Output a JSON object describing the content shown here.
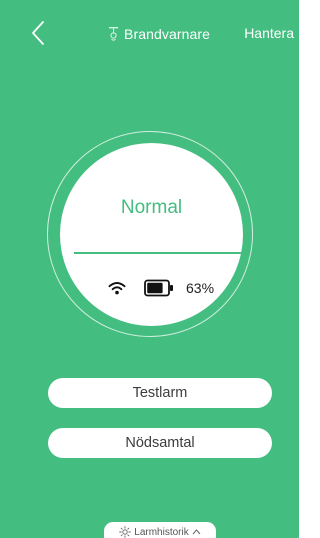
{
  "header": {
    "title": "Brandvarnare",
    "manage_label": "Hantera"
  },
  "device": {
    "status": "Normal",
    "battery_percent_label": "63%",
    "battery_level": 0.63
  },
  "actions": {
    "test_alarm_label": "Testlarm",
    "emergency_call_label": "Nödsamtal"
  },
  "footer": {
    "alarm_history_label": "Larmhistorik"
  },
  "colors": {
    "accent": "#44bd80",
    "surface": "#ffffff"
  },
  "icons": {
    "back": "chevron-left-icon",
    "device": "smoke-detector-icon",
    "wifi": "wifi-icon",
    "battery": "battery-icon",
    "history": "sun-icon",
    "expand": "chevron-up-icon"
  }
}
